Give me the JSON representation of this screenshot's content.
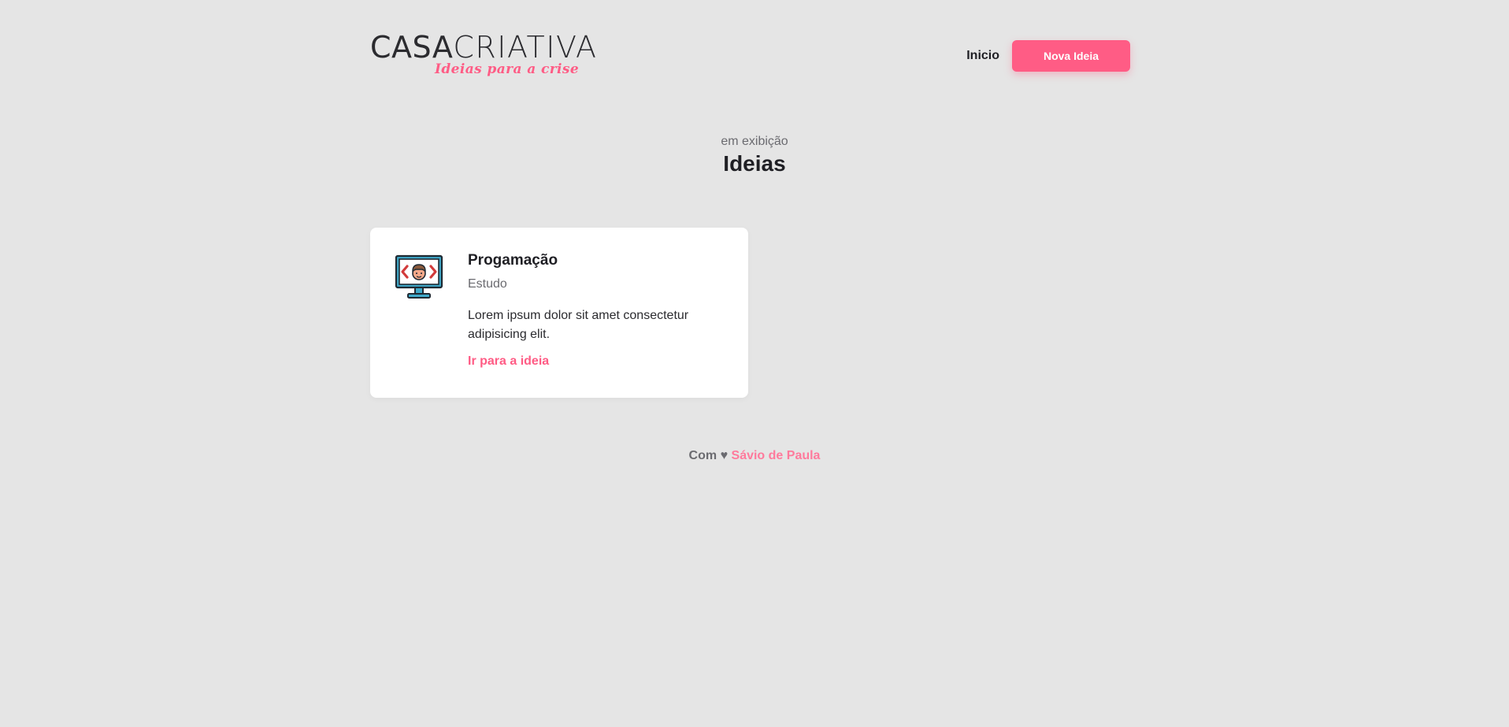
{
  "header": {
    "logo": {
      "casa": "CASA",
      "criativa": "CRIATIVA",
      "tagline": "Ideias para a crise"
    },
    "nav": {
      "home_label": "Inicio",
      "new_idea_label": "Nova Ideia"
    }
  },
  "main": {
    "subtitle": "em exibição",
    "title": "Ideias",
    "ideas": [
      {
        "title": "Progamação",
        "category": "Estudo",
        "description": "Lorem ipsum dolor sit amet consectetur adipisicing elit.",
        "link_label": "Ir para a ideia",
        "icon": "computer-code-icon"
      }
    ]
  },
  "footer": {
    "prefix": "Com",
    "heart": "♥",
    "author": "Sávio de Paula"
  },
  "colors": {
    "accent": "#ff5c85",
    "background": "#e5e5e5",
    "card": "#ffffff",
    "text": "#1f1f24",
    "muted": "#6b6b70"
  }
}
